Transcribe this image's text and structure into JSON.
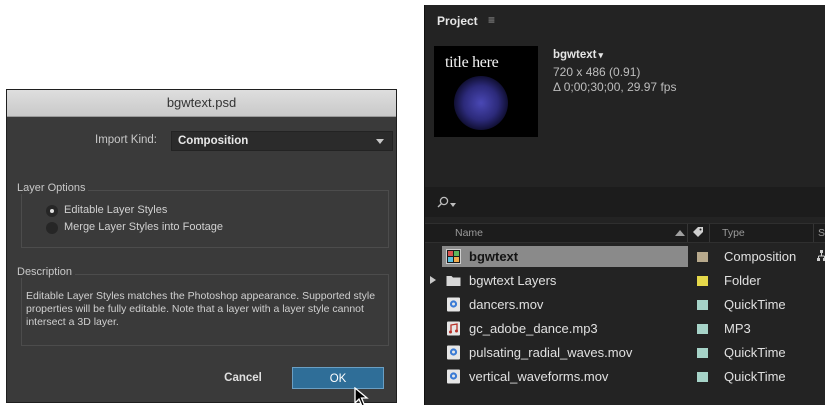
{
  "dialog": {
    "title": "bgwtext.psd",
    "import_kind_label": "Import Kind:",
    "import_kind_value": "Composition",
    "layer_options": {
      "title": "Layer Options",
      "options": [
        {
          "label": "Editable Layer Styles",
          "selected": true
        },
        {
          "label": "Merge Layer Styles into Footage",
          "selected": false
        }
      ]
    },
    "description": {
      "title": "Description",
      "text": "Editable Layer Styles matches the Photoshop appearance. Supported style properties will be fully editable. Note that a layer with a layer style cannot intersect a 3D layer."
    },
    "cancel_label": "Cancel",
    "ok_label": "OK"
  },
  "project": {
    "title": "Project",
    "menu_icon": "≡",
    "thumbnail_text": "title here",
    "comp": {
      "name": "bgwtext",
      "caret": "▾",
      "size": "720 x 486 (0.91)",
      "duration": "Δ 0;00;30;00, 29.97 fps"
    },
    "columns": {
      "name": "Name",
      "type": "Type",
      "extra": "S"
    },
    "items": [
      {
        "name": "bgwtext",
        "type": "Composition",
        "icon": "composition-icon",
        "label_color": "#b7a98c",
        "selected": true
      },
      {
        "name": "bgwtext Layers",
        "type": "Folder",
        "icon": "folder-icon",
        "label_color": "#e5d84a",
        "selected": false,
        "expandable": true
      },
      {
        "name": "dancers.mov",
        "type": "QuickTime",
        "icon": "quicktime-icon",
        "label_color": "#a6d3c8",
        "selected": false
      },
      {
        "name": "gc_adobe_dance.mp3",
        "type": "MP3",
        "icon": "audio-file-icon",
        "label_color": "#a6d3c8",
        "selected": false
      },
      {
        "name": "pulsating_radial_waves.mov",
        "type": "QuickTime",
        "icon": "quicktime-icon",
        "label_color": "#a6d3c8",
        "selected": false
      },
      {
        "name": "vertical_waveforms.mov",
        "type": "QuickTime",
        "icon": "quicktime-icon",
        "label_color": "#a6d3c8",
        "selected": false
      }
    ]
  }
}
